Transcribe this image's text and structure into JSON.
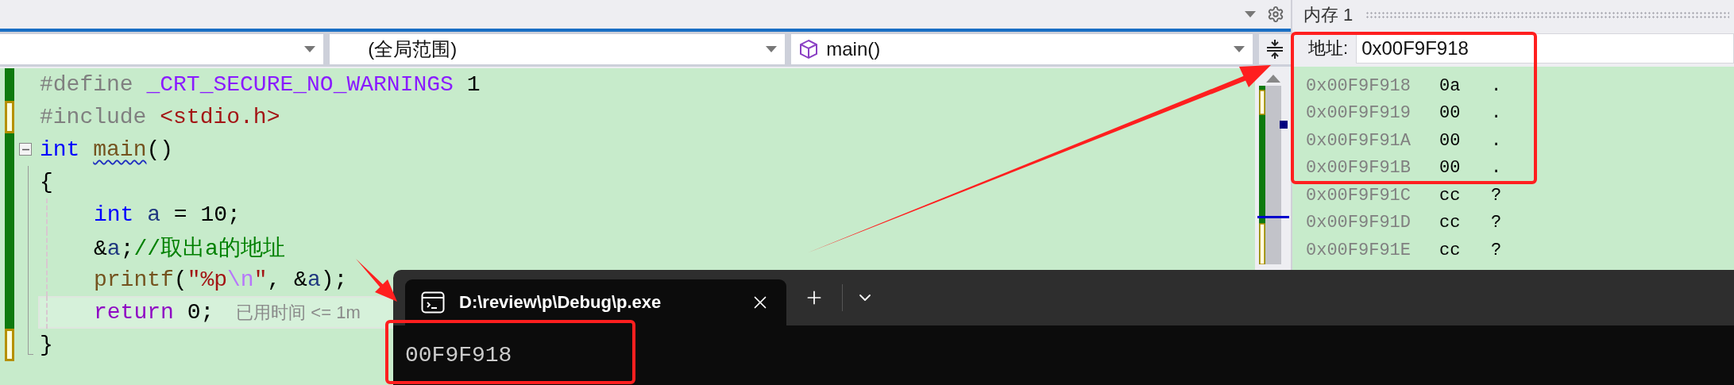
{
  "navigation_bar": {
    "dropdowns": [
      {
        "kind": "blank"
      },
      {
        "kind": "scope",
        "value": "(全局范围)"
      },
      {
        "kind": "function",
        "value": "main()"
      }
    ]
  },
  "editor": {
    "lines": [
      {
        "saved": true,
        "tokens": [
          {
            "kind": "directive",
            "text": "#define "
          },
          {
            "kind": "macro",
            "text": "_CRT_SECURE_NO_WARNINGS"
          },
          {
            "kind": "plain",
            "text": " 1"
          }
        ]
      },
      {
        "saved": false,
        "tokens": [
          {
            "kind": "directive",
            "text": "#include "
          },
          {
            "kind": "header",
            "text": "<stdio.h>"
          }
        ]
      },
      {
        "saved": true,
        "expanded": true,
        "tokens": [
          {
            "kind": "keyword",
            "text": "int "
          },
          {
            "kind": "function",
            "text": "main",
            "squiggle": true
          },
          {
            "kind": "plain",
            "text": "()"
          }
        ],
        "children": [
          {
            "saved": true,
            "tokens": [
              {
                "kind": "plain",
                "text": "{"
              }
            ]
          },
          {
            "saved": true,
            "indented": true,
            "tokens": [
              {
                "kind": "keyword",
                "text": "int "
              },
              {
                "kind": "variable",
                "text": "a"
              },
              {
                "kind": "plain",
                "text": " = 10;"
              }
            ]
          },
          {
            "saved": true,
            "indented": true,
            "tokens": [
              {
                "kind": "plain",
                "text": "&"
              },
              {
                "kind": "variable",
                "text": "a"
              },
              {
                "kind": "plain",
                "text": ";"
              },
              {
                "kind": "comment",
                "text": "//取出a的地址"
              }
            ]
          },
          {
            "saved": true,
            "indented": true,
            "tokens": [
              {
                "kind": "function",
                "text": "printf"
              },
              {
                "kind": "plain",
                "text": "("
              },
              {
                "kind": "string",
                "text": "\"%p"
              },
              {
                "kind": "escape",
                "text": "\\n"
              },
              {
                "kind": "string",
                "text": "\""
              },
              {
                "kind": "plain",
                "text": ", &"
              },
              {
                "kind": "variable",
                "text": "a"
              },
              {
                "kind": "plain",
                "text": ");"
              }
            ]
          },
          {
            "saved": true,
            "indented": true,
            "current": true,
            "hint": "已用时间 <= 1m",
            "tokens": [
              {
                "kind": "control",
                "text": "return"
              },
              {
                "kind": "plain",
                "text": " 0;"
              }
            ]
          },
          {
            "saved": false,
            "tokens": [
              {
                "kind": "plain",
                "text": "}"
              }
            ]
          }
        ]
      }
    ]
  },
  "memory": {
    "title": "内存 1",
    "address_label": "地址:",
    "address": "0x00F9F918",
    "rows": [
      {
        "address": "0x00F9F918",
        "value": "0a",
        "char": "."
      },
      {
        "address": "0x00F9F919",
        "value": "00",
        "char": "."
      },
      {
        "address": "0x00F9F91A",
        "value": "00",
        "char": "."
      },
      {
        "address": "0x00F9F91B",
        "value": "00",
        "char": "."
      },
      {
        "address": "0x00F9F91C",
        "value": "cc",
        "char": "?"
      },
      {
        "address": "0x00F9F91D",
        "value": "cc",
        "char": "?"
      },
      {
        "address": "0x00F9F91E",
        "value": "cc",
        "char": "?"
      }
    ]
  },
  "terminal": {
    "tab_title": "D:\\review\\p\\Debug\\p.exe",
    "output": "00F9F918"
  }
}
